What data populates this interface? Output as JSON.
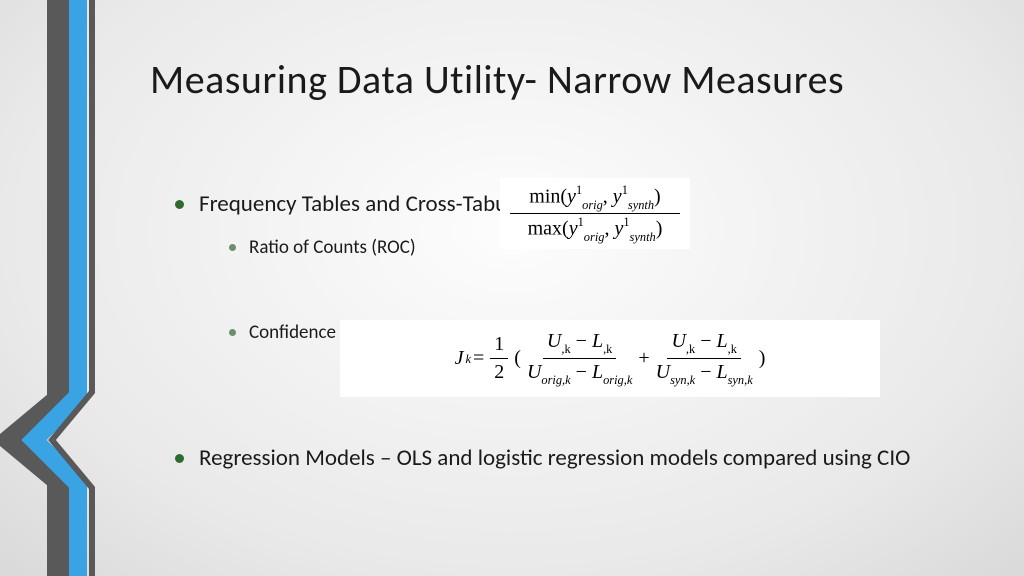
{
  "title": "Measuring Data Utility- Narrow Measures",
  "bullets": {
    "b1": "Frequency Tables and Cross-Tabulations",
    "b1a": "Ratio of Counts (ROC)",
    "b1b": "Confidence Interval Overlap (CIO)",
    "b2": "Regression Models – OLS and logistic regression models compared using CIO"
  },
  "formula1": {
    "num_fn": "min(",
    "den_fn": "max(",
    "y": "y",
    "sub1": "orig",
    "sub2": "synth",
    "sup": "1",
    "comma": ", ",
    "close": ")"
  },
  "formula2": {
    "J": "J",
    "k": "k",
    "eq": " = ",
    "half_n": "1",
    "half_d": "2",
    "open": "(",
    "U": "U",
    "L": "L",
    "minus": " − ",
    "comma_k": ",k",
    "orig_k": "orig,k",
    "syn_k": "syn,k",
    "plus": " + ",
    "close": ")"
  }
}
